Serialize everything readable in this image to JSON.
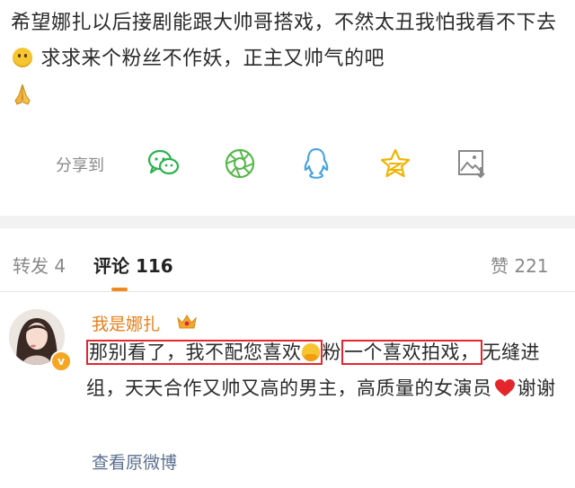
{
  "post": {
    "text_part1": "希望娜扎以后接剧能跟大帅哥搭戏，不然太丑我怕我看不下去",
    "text_part2": "求求来个粉丝不作妖，正主又帅气的吧"
  },
  "share": {
    "label": "分享到",
    "icons": [
      "wechat-icon",
      "moments-icon",
      "qq-icon",
      "qzone-icon",
      "save-image-icon"
    ]
  },
  "tabs": {
    "repost_label": "转发",
    "repost_count": "4",
    "comments_label": "评论",
    "comments_count": "116",
    "likes_label": "赞",
    "likes_count": "221"
  },
  "comment": {
    "username": "我是娜扎",
    "badge": "v",
    "highlight1": "那别看了，我不配您喜欢",
    "after_hug": "粉",
    "highlight2": "一个喜欢拍戏，",
    "text_rest": "无缝进组，天天合作又帅又高的男主，高质量的女演员",
    "thanks": "谢谢",
    "view_original": "查看原微博"
  },
  "colors": {
    "accent": "#f08a1e",
    "username": "#e8801a",
    "highlight_border": "#e5262f",
    "link": "#5b6f8f"
  }
}
